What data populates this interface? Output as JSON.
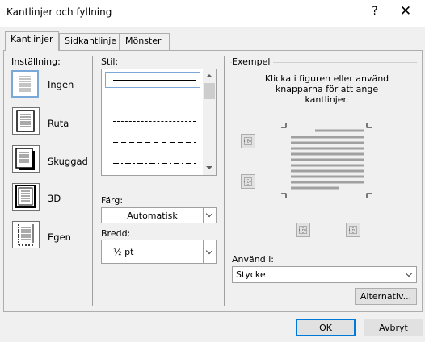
{
  "dialog": {
    "title": "Kantlinjer och fyllning",
    "help_label": "?",
    "close_label": "✕"
  },
  "tabs": [
    {
      "label": "Kantlinjer",
      "active": true
    },
    {
      "label": "Sidkantlinje",
      "active": false
    },
    {
      "label": "Mönster",
      "active": false
    }
  ],
  "settings": {
    "heading": "Inställning:",
    "items": [
      {
        "label": "Ingen",
        "selected": true,
        "icon": "border-none-icon"
      },
      {
        "label": "Ruta",
        "selected": false,
        "icon": "border-box-icon"
      },
      {
        "label": "Skuggad",
        "selected": false,
        "icon": "border-shadow-icon"
      },
      {
        "label": "3D",
        "selected": false,
        "icon": "border-3d-icon"
      },
      {
        "label": "Egen",
        "selected": false,
        "icon": "border-custom-icon"
      }
    ]
  },
  "style": {
    "heading": "Stil:",
    "options": [
      "solid",
      "dotted",
      "dashed-small",
      "dashed",
      "dash-dot"
    ],
    "selected_index": 0
  },
  "color": {
    "heading": "Färg:",
    "value": "Automatisk"
  },
  "width": {
    "heading": "Bredd:",
    "value": "½ pt"
  },
  "preview": {
    "heading": "Exempel",
    "instructions": "Klicka i figuren eller använd knapparna för att ange kantlinjer."
  },
  "apply_to": {
    "heading": "Använd i:",
    "value": "Stycke"
  },
  "buttons": {
    "options_label": "Alternativ...",
    "ok_label": "OK",
    "cancel_label": "Avbryt"
  },
  "colors": {
    "selection_border": "#7aa8d8",
    "ok_border": "#0078d7",
    "preview_lines": "#a0a0a0"
  }
}
